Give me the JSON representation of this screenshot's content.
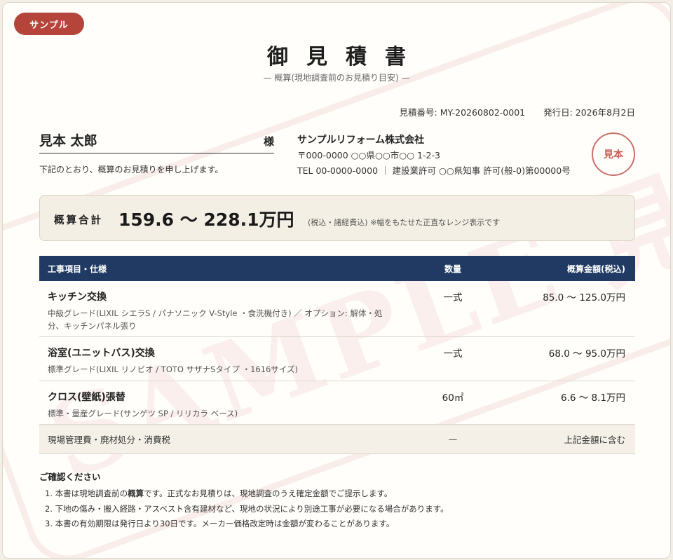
{
  "badge": "サンプル",
  "title": "御見積書",
  "subtitle": "— 概算(現地調査前のお見積り目安) —",
  "meta": {
    "estimate_no": "見積番号: MY-20260802-0001",
    "issue_date": "発行日: 2026年8月2日"
  },
  "customer": {
    "name": "見本 太郎",
    "honorific": "様",
    "intro": "下記のとおり、概算のお見積りを申し上げます。"
  },
  "company": {
    "name": "サンプルリフォーム株式会社",
    "address": "〒000-0000 ○○県○○市○○ 1-2-3",
    "contact": "TEL 00-0000-0000 ｜ 建設業許可 ○○県知事 許可(般-0)第00000号",
    "stamp": "見本"
  },
  "total": {
    "label": "概算合計",
    "value": "159.6 〜 228.1万円",
    "note": "(税込・諸経費込) ※幅をもたせた正直なレンジ表示です"
  },
  "table": {
    "headers": {
      "item": "工事項目・仕様",
      "qty": "数量",
      "amount": "概算金額(税込)"
    },
    "rows": [
      {
        "name": "キッチン交換",
        "spec": "中級グレード(LIXIL シエラS / パナソニック V-Style ・食洗機付き) ／ オプション: 解体・処分、キッチンパネル張り",
        "qty": "一式",
        "amount": "85.0 〜 125.0万円"
      },
      {
        "name": "浴室(ユニットバス)交換",
        "spec": "標準グレード(LIXIL リノビオ / TOTO サザナSタイプ ・1616サイズ)",
        "qty": "一式",
        "amount": "68.0 〜 95.0万円"
      },
      {
        "name": "クロス(壁紙)張替",
        "spec": "標準・量産グレード(サンゲツ SP / リリカラ ベース)",
        "qty": "60㎡",
        "amount": "6.6 〜 8.1万円"
      }
    ],
    "footer": {
      "item": "現場管理費・廃材処分・消費税",
      "qty": "—",
      "amount": "上記金額に含む"
    }
  },
  "notes": {
    "title": "ご確認ください",
    "item1_pre": "1. 本書は現地調査前の",
    "item1_bold": "概算",
    "item1_post": "です。正式なお見積りは、現地調査のうえ確定金額でご提示します。",
    "item2": "2. 下地の傷み・搬入経路・アスベスト含有建材など、現地の状況により別途工事が必要になる場合があります。",
    "item3": "3. 本書の有効期限は発行日より30日です。メーカー価格改定時は金額が変わることがあります。"
  },
  "watermark": "SAMPLE 見本",
  "colors": {
    "accent_red": "#b5453a",
    "header_navy": "#203a63",
    "total_bg": "#f4efe4"
  }
}
